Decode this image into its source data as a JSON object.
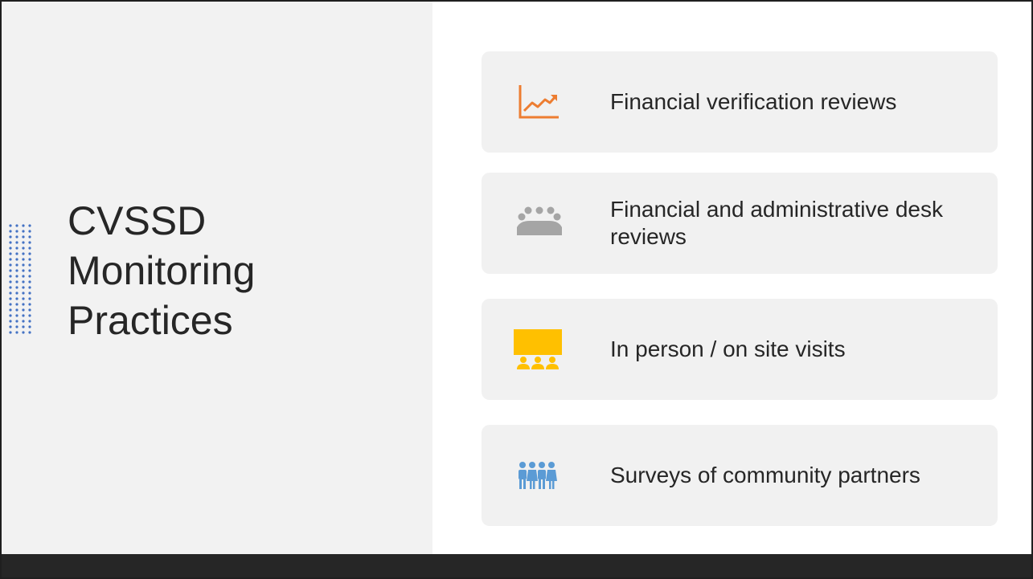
{
  "slide": {
    "title_lines": [
      "CVSSD",
      "Monitoring",
      "Practices"
    ],
    "items": [
      {
        "label": "Financial verification reviews",
        "icon": "trending-up-chart-icon",
        "icon_color": "#ED7D31"
      },
      {
        "label": "Financial and administrative desk reviews",
        "icon": "group-meeting-icon",
        "icon_color": "#A5A5A5"
      },
      {
        "label": "In person / on site visits",
        "icon": "presentation-audience-icon",
        "icon_color": "#FFC000"
      },
      {
        "label": "Surveys of community partners",
        "icon": "people-group-icon",
        "icon_color": "#5B9BD5"
      }
    ]
  },
  "colors": {
    "left_panel": "#F2F2F2",
    "card": "#F1F1F1",
    "footer_bar": "#262626",
    "dots": "#4472C4",
    "text": "#262626"
  }
}
